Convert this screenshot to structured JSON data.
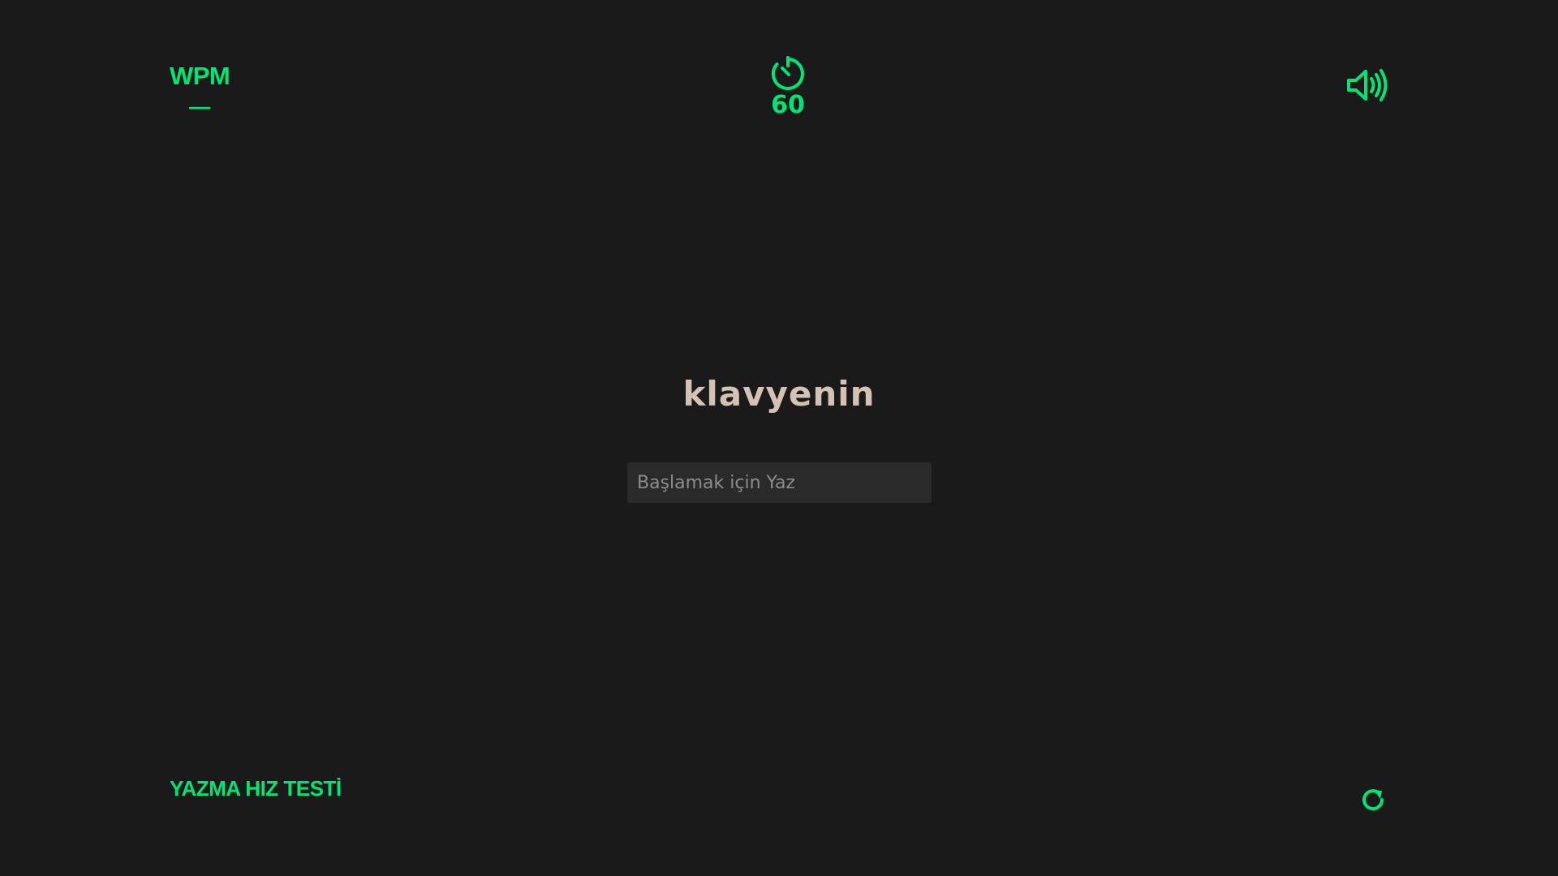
{
  "theme": {
    "accent": "#00e676",
    "background": "#1a1a1a",
    "word_color": "#d5c2b4",
    "input_background": "#2a2a2a"
  },
  "stats": {
    "wpm_label": "WPM",
    "wpm_value": "—",
    "timer_icon": "stopwatch-icon",
    "timer_value": "60"
  },
  "header": {
    "sound_icon": "volume-icon"
  },
  "main": {
    "current_word": "klavyenin",
    "input_value": "",
    "input_placeholder": "Başlamak için Yaz"
  },
  "footer": {
    "title": "YAZMA HIZ TESTİ",
    "restart_icon": "restart-icon"
  }
}
